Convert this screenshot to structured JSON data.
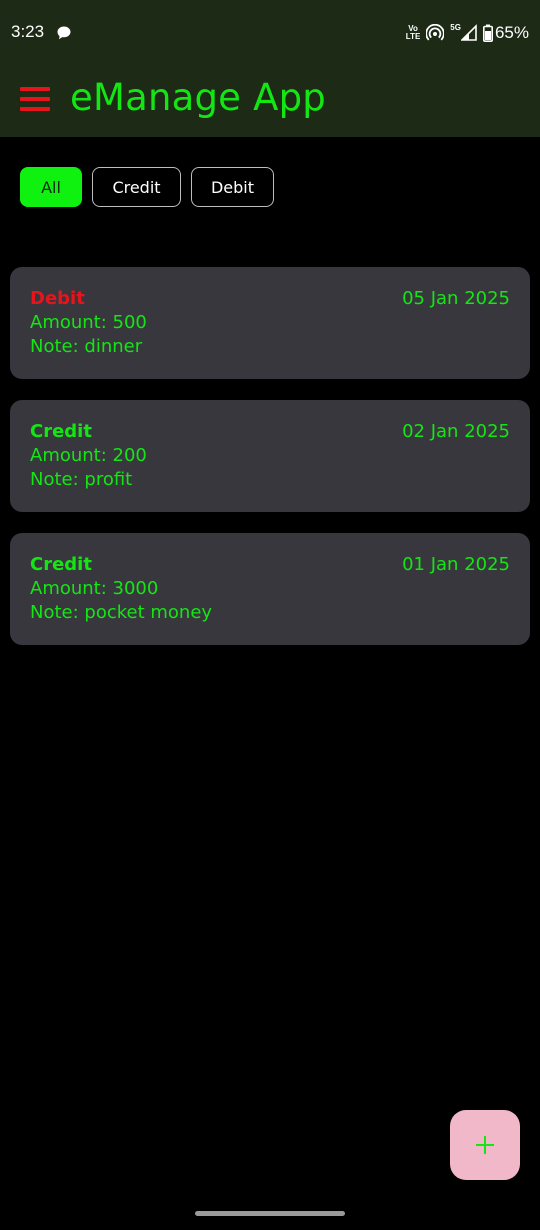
{
  "status_bar": {
    "time": "3:23",
    "volte_top": "Vo",
    "volte_bottom": "LTE",
    "network": "5G",
    "battery": "65%"
  },
  "app_bar": {
    "title": "eManage App"
  },
  "filters": [
    {
      "label": "All",
      "active": true
    },
    {
      "label": "Credit",
      "active": false
    },
    {
      "label": "Debit",
      "active": false
    }
  ],
  "transactions": [
    {
      "type": "Debit",
      "date": "05 Jan 2025",
      "amount": "Amount: 500",
      "note": "Note: dinner"
    },
    {
      "type": "Credit",
      "date": "02 Jan 2025",
      "amount": "Amount: 200",
      "note": "Note: profit"
    },
    {
      "type": "Credit",
      "date": "01 Jan 2025",
      "amount": "Amount: 3000",
      "note": "Note: pocket money"
    }
  ],
  "colors": {
    "accent_green": "#14e614",
    "debit_red": "#e8141b",
    "card_bg": "#38373e",
    "appbar_bg": "#1c2a16",
    "fab_bg": "#f0b8c9"
  },
  "icons": {
    "menu": "menu-icon",
    "add": "plus-icon",
    "chat": "chat-bubble-icon",
    "hotspot": "hotspot-icon",
    "signal": "signal-icon",
    "battery": "battery-icon"
  }
}
